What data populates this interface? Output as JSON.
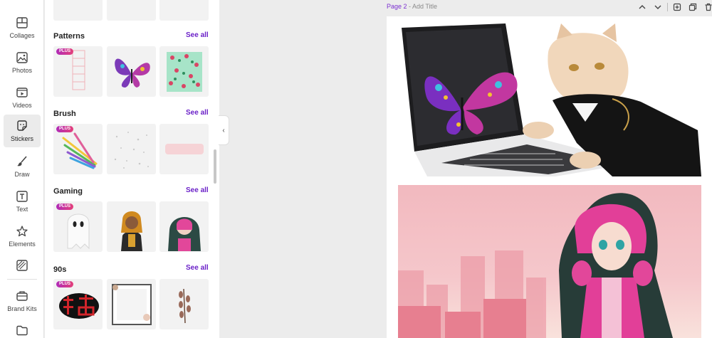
{
  "rail": {
    "items": [
      {
        "label": "Collages",
        "icon": "collage-icon"
      },
      {
        "label": "Photos",
        "icon": "image-icon"
      },
      {
        "label": "Videos",
        "icon": "video-icon"
      },
      {
        "label": "Stickers",
        "icon": "sticker-icon"
      },
      {
        "label": "Draw",
        "icon": "brush-icon"
      },
      {
        "label": "Text",
        "icon": "text-icon"
      },
      {
        "label": "Elements",
        "icon": "star-icon"
      },
      {
        "label": "Brand Kits",
        "icon": "briefcase-icon"
      }
    ],
    "active": "Stickers"
  },
  "panel": {
    "sections": [
      {
        "title": "Patterns",
        "see_all": "See all"
      },
      {
        "title": "Brush",
        "see_all": "See all"
      },
      {
        "title": "Gaming",
        "see_all": "See all"
      },
      {
        "title": "90s",
        "see_all": "See all"
      }
    ],
    "plus_badge": "PLUS",
    "accent_color": "#6b21c8"
  },
  "canvas": {
    "page_label": "Page 2",
    "separator": " - ",
    "page_title_placeholder": "Add Title"
  }
}
